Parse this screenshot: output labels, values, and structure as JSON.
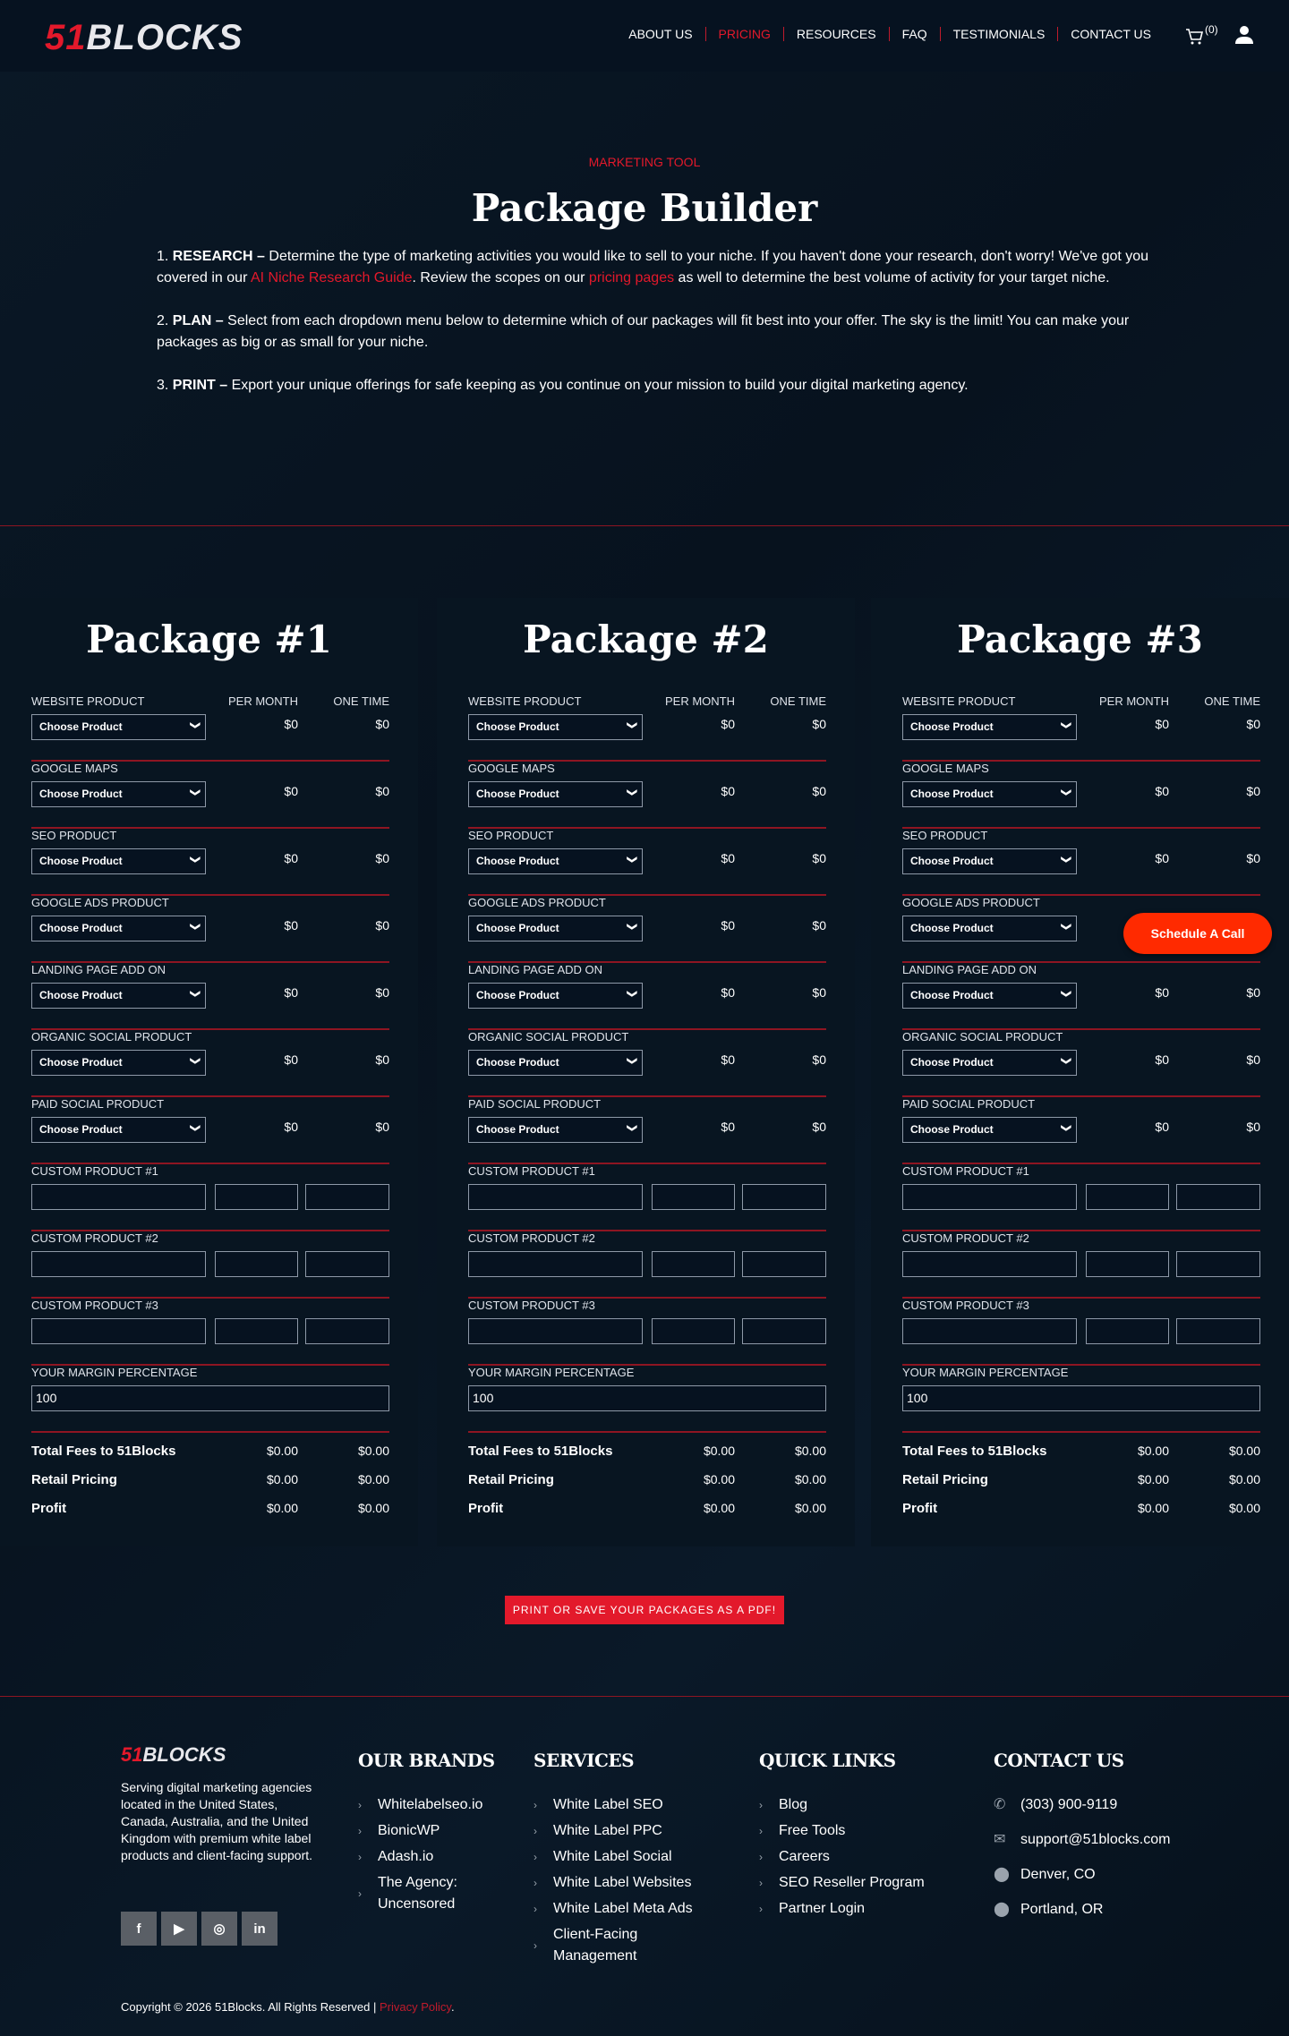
{
  "header": {
    "logo": "51BLOCKS",
    "nav": [
      {
        "label": "ABOUT US"
      },
      {
        "label": "PRICING",
        "active": true
      },
      {
        "label": "RESOURCES"
      },
      {
        "label": "FAQ"
      },
      {
        "label": "TESTIMONIALS"
      },
      {
        "label": "CONTACT US"
      }
    ],
    "cart_count": "(0)"
  },
  "intro": {
    "eyebrow": "MARKETING TOOL",
    "title": "Package Builder",
    "steps": [
      {
        "num": "1.",
        "head": "RESEARCH –",
        "t1": " Determine the type of marketing activities you would like to sell to your niche. If you haven't done your research, don't worry! We've got you covered in our ",
        "link1": "AI Niche Research Guide",
        "t2": ". Review the scopes on our ",
        "link2": "pricing pages",
        "t3": " as well to determine the best volume of activity for your target niche."
      },
      {
        "num": "2.",
        "head": "PLAN –",
        "t1": " Select from each dropdown menu below to determine which of our packages will fit best into your offer. The sky is the limit! You can make your packages as big or as small for your niche."
      },
      {
        "num": "3.",
        "head": "PRINT –",
        "t1": " Export your unique offerings for safe keeping as you continue on your mission to build your digital marketing agency."
      }
    ]
  },
  "columns": {
    "per_month": "PER MONTH",
    "one_time": "ONE TIME"
  },
  "packages": [
    {
      "title": "Package #1",
      "products": [
        {
          "label": "WEBSITE PRODUCT",
          "selected": "Choose Product",
          "per_month": "$0",
          "one_time": "$0"
        },
        {
          "label": "GOOGLE MAPS",
          "selected": "Choose Product",
          "per_month": "$0",
          "one_time": "$0"
        },
        {
          "label": "SEO PRODUCT",
          "selected": "Choose Product",
          "per_month": "$0",
          "one_time": "$0"
        },
        {
          "label": "GOOGLE ADS PRODUCT",
          "selected": "Choose Product",
          "per_month": "$0",
          "one_time": "$0"
        },
        {
          "label": "LANDING PAGE ADD ON",
          "selected": "Choose Product",
          "per_month": "$0",
          "one_time": "$0"
        },
        {
          "label": "ORGANIC SOCIAL PRODUCT",
          "selected": "Choose Product",
          "per_month": "$0",
          "one_time": "$0"
        },
        {
          "label": "PAID SOCIAL PRODUCT",
          "selected": "Choose Product",
          "per_month": "$0",
          "one_time": "$0"
        }
      ],
      "custom": [
        {
          "label": "CUSTOM PRODUCT #1"
        },
        {
          "label": "CUSTOM PRODUCT #2"
        },
        {
          "label": "CUSTOM PRODUCT #3"
        }
      ],
      "margin": {
        "label": "YOUR MARGIN PERCENTAGE",
        "value": "100"
      },
      "totals": [
        {
          "label": "Total Fees to 51Blocks",
          "per_month": "$0.00",
          "one_time": "$0.00"
        },
        {
          "label": "Retail Pricing",
          "per_month": "$0.00",
          "one_time": "$0.00"
        },
        {
          "label": "Profit",
          "per_month": "$0.00",
          "one_time": "$0.00"
        }
      ]
    },
    {
      "title": "Package #2",
      "products": [
        {
          "label": "WEBSITE PRODUCT",
          "selected": "Choose Product",
          "per_month": "$0",
          "one_time": "$0"
        },
        {
          "label": "GOOGLE MAPS",
          "selected": "Choose Product",
          "per_month": "$0",
          "one_time": "$0"
        },
        {
          "label": "SEO PRODUCT",
          "selected": "Choose Product",
          "per_month": "$0",
          "one_time": "$0"
        },
        {
          "label": "GOOGLE ADS PRODUCT",
          "selected": "Choose Product",
          "per_month": "$0",
          "one_time": "$0"
        },
        {
          "label": "LANDING PAGE ADD ON",
          "selected": "Choose Product",
          "per_month": "$0",
          "one_time": "$0"
        },
        {
          "label": "ORGANIC SOCIAL PRODUCT",
          "selected": "Choose Product",
          "per_month": "$0",
          "one_time": "$0"
        },
        {
          "label": "PAID SOCIAL PRODUCT",
          "selected": "Choose Product",
          "per_month": "$0",
          "one_time": "$0"
        }
      ],
      "custom": [
        {
          "label": "CUSTOM PRODUCT #1"
        },
        {
          "label": "CUSTOM PRODUCT #2"
        },
        {
          "label": "CUSTOM PRODUCT #3"
        }
      ],
      "margin": {
        "label": "YOUR MARGIN PERCENTAGE",
        "value": "100"
      },
      "totals": [
        {
          "label": "Total Fees to 51Blocks",
          "per_month": "$0.00",
          "one_time": "$0.00"
        },
        {
          "label": "Retail Pricing",
          "per_month": "$0.00",
          "one_time": "$0.00"
        },
        {
          "label": "Profit",
          "per_month": "$0.00",
          "one_time": "$0.00"
        }
      ]
    },
    {
      "title": "Package #3",
      "products": [
        {
          "label": "WEBSITE PRODUCT",
          "selected": "Choose Product",
          "per_month": "$0",
          "one_time": "$0"
        },
        {
          "label": "GOOGLE MAPS",
          "selected": "Choose Product",
          "per_month": "$0",
          "one_time": "$0"
        },
        {
          "label": "SEO PRODUCT",
          "selected": "Choose Product",
          "per_month": "$0",
          "one_time": "$0"
        },
        {
          "label": "GOOGLE ADS PRODUCT",
          "selected": "Choose Product",
          "per_month": "",
          "one_time": ""
        },
        {
          "label": "LANDING PAGE ADD ON",
          "selected": "Choose Product",
          "per_month": "$0",
          "one_time": "$0"
        },
        {
          "label": "ORGANIC SOCIAL PRODUCT",
          "selected": "Choose Product",
          "per_month": "$0",
          "one_time": "$0"
        },
        {
          "label": "PAID SOCIAL PRODUCT",
          "selected": "Choose Product",
          "per_month": "$0",
          "one_time": "$0"
        }
      ],
      "custom": [
        {
          "label": "CUSTOM PRODUCT #1"
        },
        {
          "label": "CUSTOM PRODUCT #2"
        },
        {
          "label": "CUSTOM PRODUCT #3"
        }
      ],
      "margin": {
        "label": "YOUR MARGIN PERCENTAGE",
        "value": "100"
      },
      "totals": [
        {
          "label": "Total Fees to 51Blocks",
          "per_month": "$0.00",
          "one_time": "$0.00"
        },
        {
          "label": "Retail Pricing",
          "per_month": "$0.00",
          "one_time": "$0.00"
        },
        {
          "label": "Profit",
          "per_month": "$0.00",
          "one_time": "$0.00"
        }
      ]
    }
  ],
  "schedule_call": "Schedule A Call",
  "print_button": "PRINT OR SAVE YOUR PACKAGES AS A PDF!",
  "footer": {
    "logo": "51BLOCKS",
    "description": "Serving digital marketing agencies located in the United States, Canada, Australia, and the United Kingdom with premium white label products and client-facing support.",
    "social": [
      "facebook",
      "youtube",
      "instagram",
      "linkedin"
    ],
    "brands": {
      "title": "OUR BRANDS",
      "items": [
        "Whitelabelseo.io",
        "BionicWP",
        "Adash.io",
        "The Agency: Uncensored"
      ]
    },
    "services": {
      "title": "SERVICES",
      "items": [
        "White Label SEO",
        "White Label PPC",
        "White Label Social",
        "White Label Websites",
        "White Label Meta Ads",
        "Client-Facing Management"
      ]
    },
    "quick_links": {
      "title": "QUICK LINKS",
      "items": [
        "Blog",
        "Free Tools",
        "Careers",
        "SEO Reseller Program",
        "Partner Login"
      ]
    },
    "contact": {
      "title": "CONTACT US",
      "phone": "(303) 900-9119",
      "email": "support@51blocks.com",
      "locations": [
        "Denver, CO",
        "Portland, OR"
      ]
    },
    "copyright": "Copyright © 2026 51Blocks. All Rights Reserved | ",
    "privacy": "Privacy Policy",
    "period": "."
  },
  "colors": {
    "accent": "#e3192b",
    "cta": "#ff2a00",
    "bg": "#07121e"
  }
}
